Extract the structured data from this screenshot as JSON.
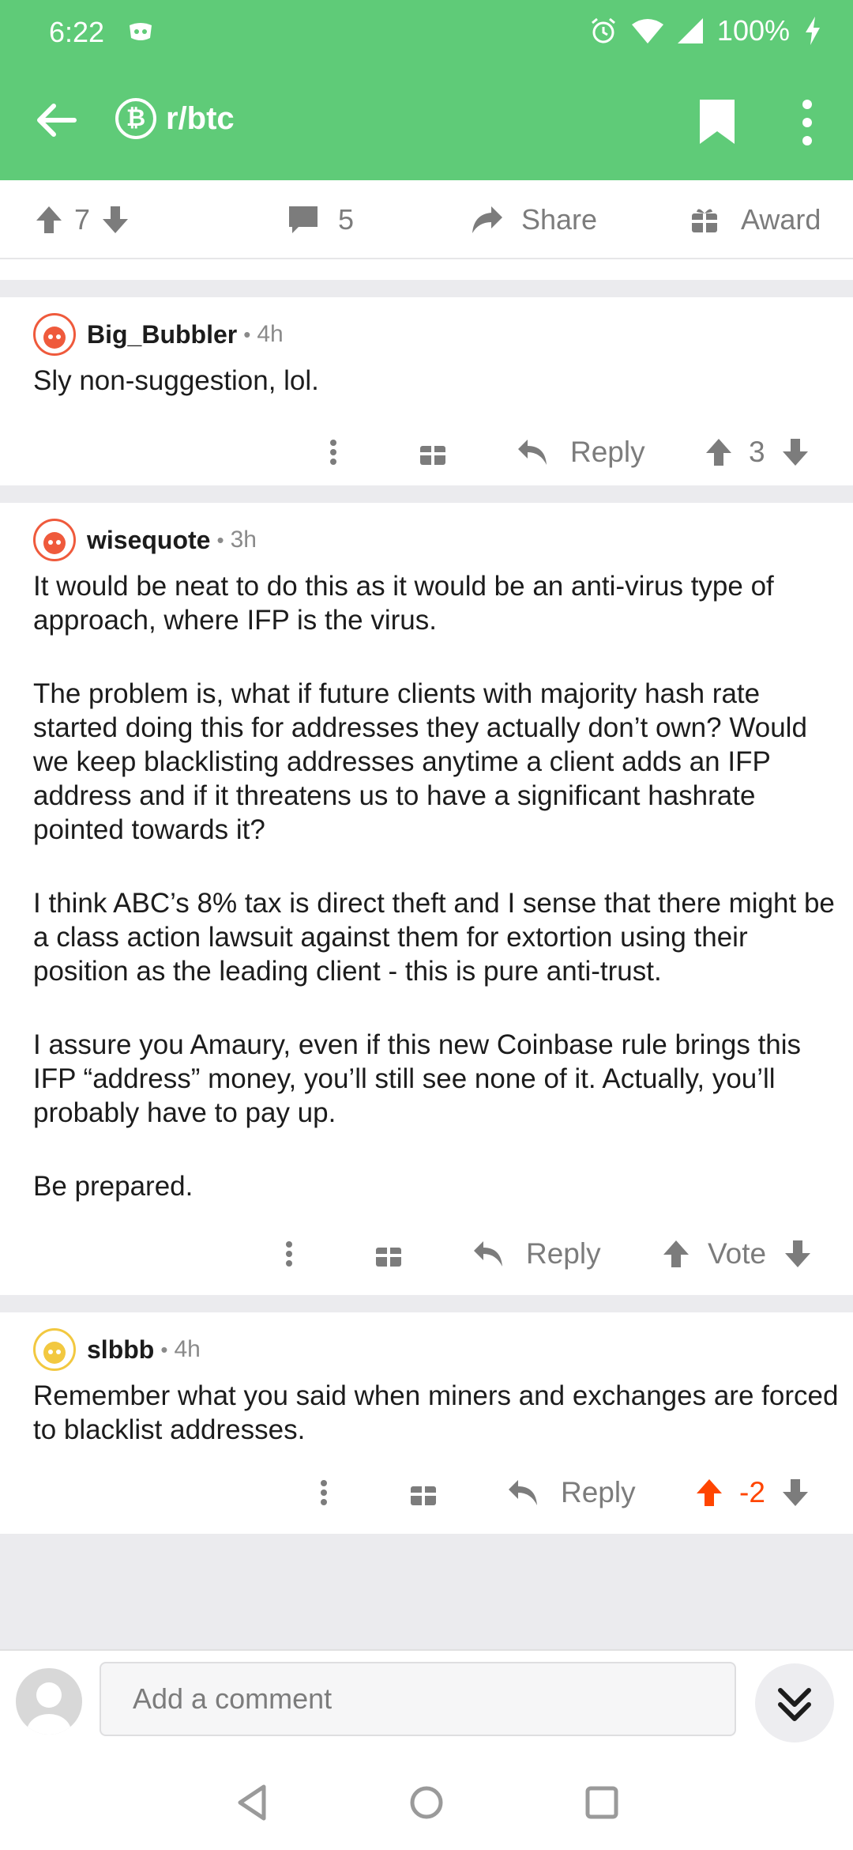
{
  "status_bar": {
    "time": "6:22",
    "battery": "100%"
  },
  "app_bar": {
    "subreddit": "r/btc",
    "sub_icon_glyph": "₿"
  },
  "post_actions": {
    "score": "7",
    "comments": "5",
    "share_label": "Share",
    "award_label": "Award"
  },
  "comments": [
    {
      "username": "Big_Bubbler",
      "time": "4h",
      "paragraphs": [
        "Sly non-suggestion, lol."
      ],
      "reply_label": "Reply",
      "vote": "3"
    },
    {
      "username": "wisequote",
      "time": "3h",
      "paragraphs": [
        "It would be neat to do this as it would be an anti-virus type of approach, where IFP is the virus.",
        "The problem is, what if future clients with majority hash rate started doing this for addresses they actually don’t own? Would we keep blacklisting addresses anytime a client adds an IFP address and if it threatens us to have a significant hashrate pointed towards it?",
        "I think ABC’s 8% tax is direct theft and I sense that there might be a class action lawsuit against them for extortion using their position as the leading client - this is pure anti-trust.",
        "I assure you Amaury, even if this new Coinbase rule brings this IFP “address” money, you’ll still see none of it. Actually, you’ll probably have to pay up.",
        "Be prepared."
      ],
      "reply_label": "Reply",
      "vote": "Vote"
    },
    {
      "username": "slbbb",
      "time": "4h",
      "paragraphs": [
        "Remember what you said when miners and exchanges are forced to blacklist addresses."
      ],
      "reply_label": "Reply",
      "vote": "-2"
    }
  ],
  "composer": {
    "placeholder": "Add a comment"
  },
  "colors": {
    "brand_green": "#5fcb78",
    "upvote_orange": "#ff4500",
    "icon_gray": "#7c7c7c"
  }
}
